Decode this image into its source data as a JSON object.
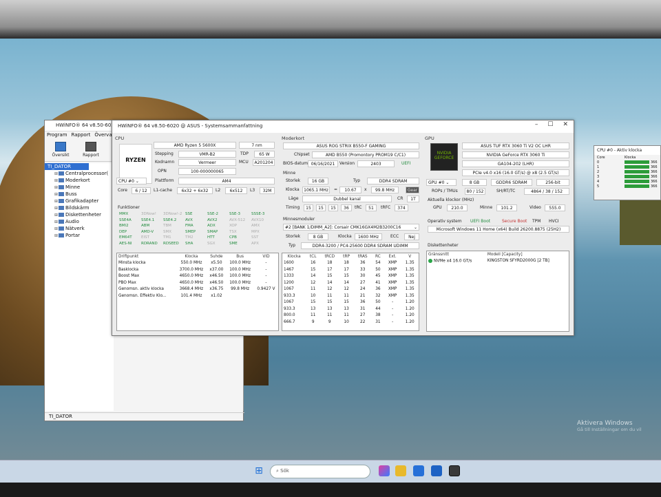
{
  "main_window": {
    "title": "HWiNFO® 64 v8.50-6020",
    "menu": [
      "Program",
      "Rapport",
      "Överva"
    ],
    "toolbar": [
      "Översikt",
      "Rapport"
    ],
    "tree": {
      "root": "TI_DATOR",
      "items": [
        "Centralprocessor(",
        "Moderkort",
        "Minne",
        "Buss",
        "Grafikadapter",
        "Bildskärm",
        "Diskettenheter",
        "Audio",
        "Nätverk",
        "Portar"
      ]
    },
    "status": "TI_DATOR"
  },
  "summary_window": {
    "title": "HWiNFO® 64 v8.50-6020 @ ASUS - Systemsammanfattning",
    "cpu": {
      "header": "CPU",
      "logo": "RYZEN",
      "name": "AMD Ryzen 5 5600X",
      "nm": "7 nm",
      "stepping_label": "Stepping",
      "stepping": "VMR-B2",
      "tdp_label": "TDP",
      "tdp": "65 W",
      "codename_label": "Kodnamn",
      "codename": "Vermeer",
      "mcu_label": "MCU",
      "mcu": "A201204",
      "opn_label": "OPN",
      "opn": "100-000000065",
      "select": "CPU #0",
      "platform_label": "Plattform",
      "platform": "AM4",
      "core_label": "Core",
      "core": "6 / 12",
      "l1_label": "L1-cache",
      "l1": "6x32 + 6x32",
      "l2_label": "L2",
      "l2": "6x512",
      "l3_label": "L3",
      "l3": "32M",
      "features_label": "Funktioner",
      "features": [
        [
          [
            "MMX",
            "on"
          ],
          [
            "3DNow!",
            "off"
          ],
          [
            "3DNow!-2",
            "off"
          ],
          [
            "SSE",
            "on"
          ],
          [
            "SSE-2",
            "on"
          ],
          [
            "SSE-3",
            "on"
          ],
          [
            "SSSE-3",
            "on"
          ]
        ],
        [
          [
            "SSE4A",
            "on"
          ],
          [
            "SSE4.1",
            "on"
          ],
          [
            "SSE4.2",
            "on"
          ],
          [
            "AVX",
            "on"
          ],
          [
            "AVX2",
            "on"
          ],
          [
            "AVX-512",
            "off"
          ],
          [
            "AVX10",
            "off"
          ]
        ],
        [
          [
            "BMI2",
            "on"
          ],
          [
            "ABM",
            "on"
          ],
          [
            "TBM",
            "off"
          ],
          [
            "FMA",
            "on"
          ],
          [
            "ADX",
            "on"
          ],
          [
            "XOP",
            "off"
          ],
          [
            "AMX",
            "off"
          ]
        ],
        [
          [
            "DEP",
            "on"
          ],
          [
            "AMD-V",
            "on"
          ],
          [
            "SMX",
            "off"
          ],
          [
            "SMEP",
            "on"
          ],
          [
            "SMAP",
            "on"
          ],
          [
            "TSX",
            "off"
          ],
          [
            "MPX",
            "off"
          ]
        ],
        [
          [
            "EM64T",
            "on"
          ],
          [
            "EIST",
            "off"
          ],
          [
            "TM1",
            "off"
          ],
          [
            "TM2",
            "off"
          ],
          [
            "HTT",
            "on"
          ],
          [
            "CPB",
            "on"
          ],
          [
            "SST",
            "off"
          ]
        ],
        [
          [
            "AES-NI",
            "on"
          ],
          [
            "RDRAND",
            "on"
          ],
          [
            "RDSEED",
            "on"
          ],
          [
            "SHA",
            "on"
          ],
          [
            "SGX",
            "off"
          ],
          [
            "SME",
            "on"
          ],
          [
            "APX",
            "off"
          ]
        ]
      ],
      "ops_headers": [
        "Driftpunkt",
        "Klocka",
        "Suhde",
        "Bus",
        "VID"
      ],
      "ops": [
        [
          "Minsta klocka",
          "550.0 MHz",
          "x5.50",
          "100.0 MHz",
          "-"
        ],
        [
          "Basklocka",
          "3700.0 MHz",
          "x37.00",
          "100.0 MHz",
          "-"
        ],
        [
          "Boost Max",
          "4650.0 MHz",
          "x46.50",
          "100.0 MHz",
          "-"
        ],
        [
          "PBO Max",
          "4650.0 MHz",
          "x46.50",
          "100.0 MHz",
          "-"
        ],
        [
          "Genomsn. aktiv klocka",
          "3668.4 MHz",
          "x36.75",
          "99.8 MHz",
          "0.9427 V"
        ],
        [
          "Genomsn. Effektiv Klo...",
          "101.4 MHz",
          "x1.02",
          "",
          ""
        ]
      ]
    },
    "mobo": {
      "header": "Moderkort",
      "name": "ASUS ROG STRIX B550-F GAMING",
      "chipset_label": "Chipset",
      "chipset": "AMD B550 (Promontory PROM19 C/C1)",
      "bios_label": "BIOS-datum",
      "bios_date": "06/16/2021",
      "version_label": "Version",
      "version": "2403",
      "uefi": "UEFI",
      "mem_header": "Minne",
      "size_label": "Storlek",
      "size": "16 GB",
      "type_label": "Typ",
      "type": "DDR4 SDRAM",
      "clock_label": "Klocka",
      "clock": "1065.1 MHz",
      "eq": "=",
      "mult": "10.67",
      "x": "x",
      "bclk": "99.8 MHz",
      "gear": "Gear",
      "mode_label": "Läge",
      "mode": "Dubbel kanal",
      "cr_label": "CR",
      "cr": "1T",
      "timing_label": "Timing",
      "timings": [
        "15",
        "15",
        "15",
        "36"
      ],
      "trc_label": "tRC",
      "trc": "51",
      "trfc_label": "tRFC",
      "trfc": "374",
      "modules_label": "Minnesmoduler",
      "module_select": "#2 [BANK 1/DIMM_A2]: Corsair CMK16GX4M2B3200C16",
      "mod_size_label": "Storlek",
      "mod_size": "8 GB",
      "mod_clock_label": "Klocka",
      "mod_clock": "1600 MHz",
      "ecc_label": "ECC",
      "ecc": "Nej",
      "mod_type_label": "Typ",
      "mod_type": "DDR4-3200 / PC4-25600 DDR4 SDRAM UDIMM",
      "spd_headers": [
        "Klocka",
        "tCL",
        "tRCD",
        "tRP",
        "tRAS",
        "RC",
        "Ext.",
        "V"
      ],
      "spd": [
        [
          "1600",
          "16",
          "18",
          "18",
          "36",
          "54",
          "XMP",
          "1.35"
        ],
        [
          "1467",
          "15",
          "17",
          "17",
          "33",
          "50",
          "XMP",
          "1.35"
        ],
        [
          "1333",
          "14",
          "15",
          "15",
          "30",
          "45",
          "XMP",
          "1.35"
        ],
        [
          "1200",
          "12",
          "14",
          "14",
          "27",
          "41",
          "XMP",
          "1.35"
        ],
        [
          "1067",
          "11",
          "12",
          "12",
          "24",
          "36",
          "XMP",
          "1.35"
        ],
        [
          "933.3",
          "10",
          "11",
          "11",
          "21",
          "32",
          "XMP",
          "1.35"
        ],
        [
          "1067",
          "15",
          "15",
          "15",
          "36",
          "50",
          "-",
          "1.20"
        ],
        [
          "933.3",
          "13",
          "13",
          "13",
          "31",
          "44",
          "-",
          "1.20"
        ],
        [
          "800.0",
          "11",
          "11",
          "11",
          "27",
          "38",
          "-",
          "1.20"
        ],
        [
          "666.7",
          "9",
          "9",
          "10",
          "22",
          "31",
          "-",
          "1.20"
        ]
      ]
    },
    "gpu": {
      "header": "GPU",
      "logo": "NVIDIA GEFORCE",
      "name": "ASUS TUF RTX 3060 Ti V2 OC LHR",
      "chip": "NVIDIA GeForce RTX 3060 Ti",
      "variant": "GA104-202 (LHR)",
      "bus": "PCIe v4.0 x16 (16.0 GT/s) @ x8 (2.5 GT/s)",
      "select": "GPU #0",
      "vram": "8 GB",
      "vram_type": "GDDR6 SDRAM",
      "bus_width": "256-bit",
      "rops_label": "ROPs / TMUs",
      "rops": "80 / 152",
      "sh_label": "SH/RT/TC",
      "sh": "4864 / 38 / 152",
      "clocks_label": "Aktuella klockor (MHz)",
      "gpu_clk_label": "GPU",
      "gpu_clk": "210.0",
      "mem_clk_label": "Minne",
      "mem_clk": "101.2",
      "video_clk_label": "Video",
      "video_clk": "555.0",
      "os_label": "Operativ system",
      "uefi_boot": "UEFI Boot",
      "secure_boot": "Secure Boot",
      "tpm": "TPM",
      "hvci": "HVCI",
      "os": "Microsoft Windows 11 Home (x64) Build 26200.8875 (25H2)",
      "drives_label": "Diskettenheter",
      "drive_headers": [
        "Gränssnitt",
        "Modell [Capacity]"
      ],
      "drives": [
        [
          "NVMe x4 16.0 GT/s",
          "KINGSTON SFYRD2000G [2 TB]"
        ]
      ]
    }
  },
  "clock_window": {
    "title": "CPU #0 - Aktiv klocka",
    "col_core": "Core",
    "col_clock": "Klocka",
    "cores": [
      {
        "core": "0",
        "clock": "366"
      },
      {
        "core": "1",
        "clock": "366"
      },
      {
        "core": "2",
        "clock": "366"
      },
      {
        "core": "3",
        "clock": "366"
      },
      {
        "core": "4",
        "clock": "366"
      },
      {
        "core": "5",
        "clock": "366"
      }
    ]
  },
  "watermark": {
    "title": "Aktivera Windows",
    "subtitle": "Gå till Inställningar om du vil"
  },
  "taskbar": {
    "search_placeholder": "Sök"
  },
  "colors": {
    "accent_blue": "#2f6fd1",
    "feature_on": "#1f8a3c",
    "feature_off": "#aaaaaa",
    "ok_green": "#2aa548",
    "nvidia_green": "#76b900"
  }
}
